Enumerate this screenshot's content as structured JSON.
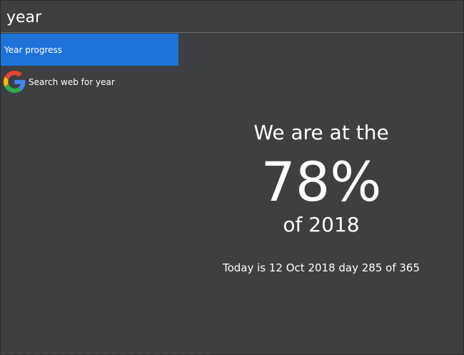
{
  "search": {
    "value": "year"
  },
  "results": [
    {
      "label": "Year progress",
      "selected": true
    },
    {
      "label": "Search web for year",
      "icon": "google-g-icon"
    }
  ],
  "preview": {
    "line1": "We are at the",
    "percent": "78%",
    "line3": "of 2018",
    "today": "Today is 12 Oct 2018 day 285 of 365"
  },
  "colors": {
    "background": "#3d3f43",
    "selected": "#1e73d8",
    "text": "#ffffff",
    "divider": "#6a6c70"
  }
}
